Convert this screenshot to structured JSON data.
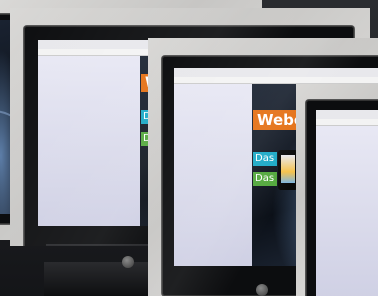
{
  "photo": {
    "subject": "four monitors displaying the same website",
    "screen_text": {
      "logo": "Weben",
      "tag_1": "Das",
      "tag_2": "Das"
    },
    "colors": {
      "logo": "#e46f12",
      "tag_cyan": "#1aa9c6",
      "tag_green": "#52a83c",
      "wall": "#d6d5d3",
      "bezel": "#0c0d0f"
    }
  }
}
